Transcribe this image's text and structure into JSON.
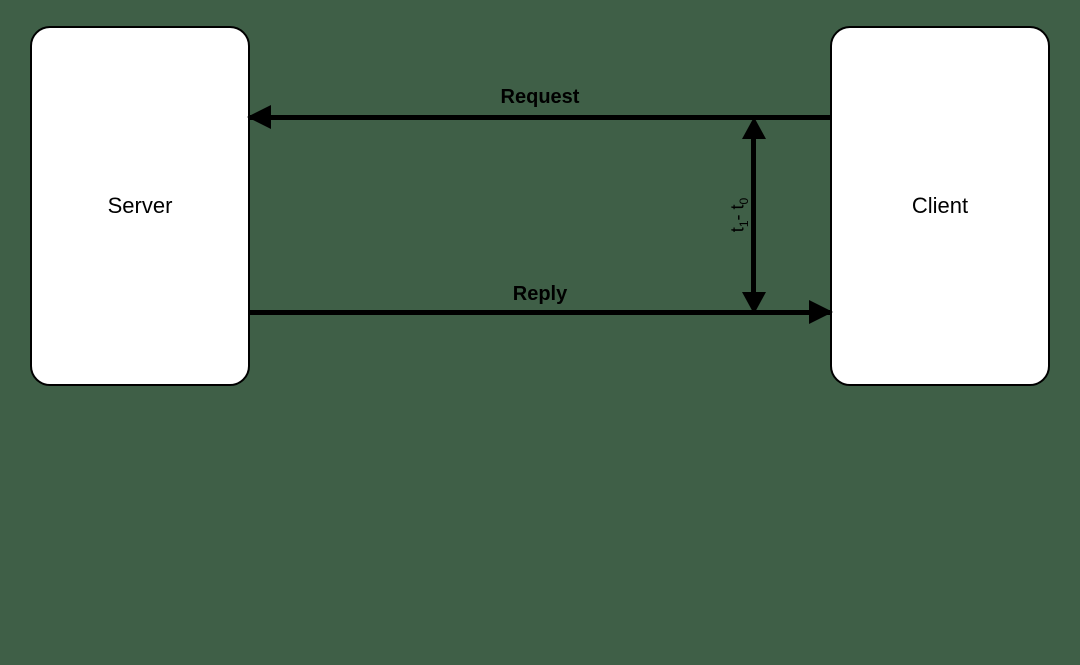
{
  "nodes": {
    "server": {
      "label": "Server"
    },
    "client": {
      "label": "Client"
    }
  },
  "arrows": {
    "request": {
      "label": "Request"
    },
    "reply": {
      "label": "Reply"
    }
  },
  "elapsed": {
    "t1": "t",
    "sub1": "1",
    "minus": "- t",
    "sub0": "0"
  }
}
